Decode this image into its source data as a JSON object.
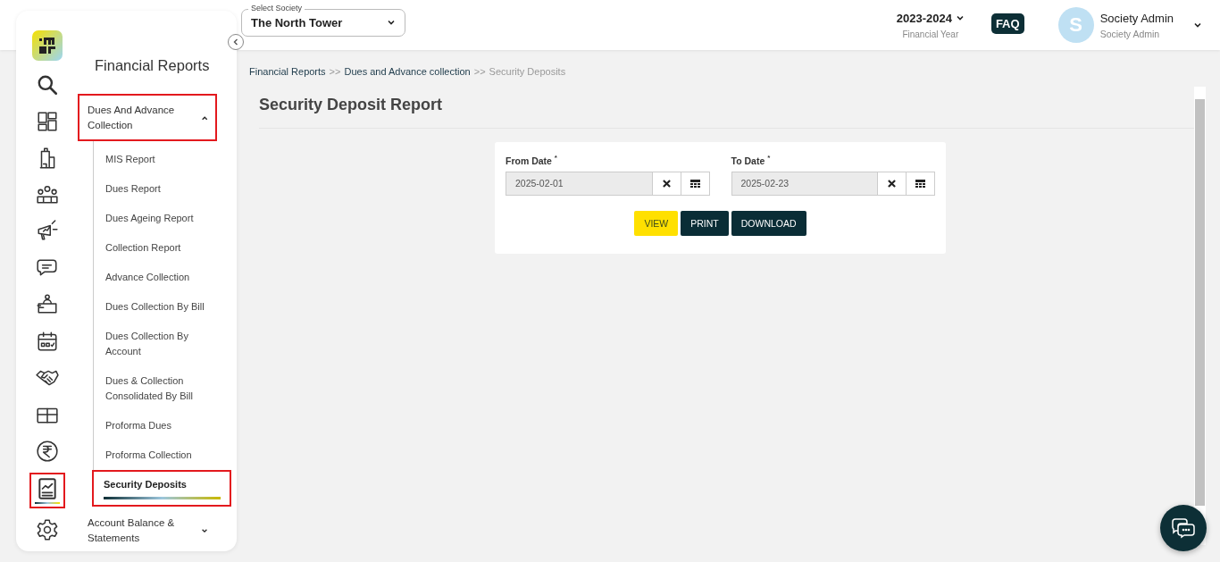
{
  "header": {
    "society_select": {
      "label": "Select Society",
      "value": "The North Tower"
    },
    "financial_year": {
      "value": "2023-2024",
      "label": "Financial Year"
    },
    "faq": "FAQ",
    "user": {
      "initial": "S",
      "name": "Society Admin",
      "role": "Society Admin"
    }
  },
  "rail": [
    {
      "kind": "logo",
      "selected": false,
      "highlighted": false
    },
    {
      "kind": "search",
      "selected": false,
      "highlighted": false
    },
    {
      "kind": "dashboard",
      "selected": false,
      "highlighted": false
    },
    {
      "kind": "building",
      "selected": false,
      "highlighted": false
    },
    {
      "kind": "people",
      "selected": false,
      "highlighted": false
    },
    {
      "kind": "megaphone",
      "selected": false,
      "highlighted": false
    },
    {
      "kind": "chat",
      "selected": false,
      "highlighted": false
    },
    {
      "kind": "desk",
      "selected": false,
      "highlighted": false
    },
    {
      "kind": "calendar",
      "selected": false,
      "highlighted": false
    },
    {
      "kind": "handshake",
      "selected": false,
      "highlighted": false
    },
    {
      "kind": "box",
      "selected": false,
      "highlighted": false
    },
    {
      "kind": "rupee",
      "selected": false,
      "highlighted": false
    },
    {
      "kind": "report",
      "selected": true,
      "highlighted": true
    },
    {
      "kind": "gear",
      "selected": false,
      "highlighted": false
    }
  ],
  "nav": {
    "title": "Financial Reports",
    "groups": [
      {
        "label": "Dues And Advance Collection",
        "expanded": true,
        "highlighted": true,
        "children": [
          {
            "label": "MIS Report",
            "selected": false,
            "highlighted": false
          },
          {
            "label": "Dues Report",
            "selected": false,
            "highlighted": false
          },
          {
            "label": "Dues Ageing Report",
            "selected": false,
            "highlighted": false
          },
          {
            "label": "Collection Report",
            "selected": false,
            "highlighted": false
          },
          {
            "label": "Advance Collection",
            "selected": false,
            "highlighted": false
          },
          {
            "label": "Dues Collection By Bill",
            "selected": false,
            "highlighted": false
          },
          {
            "label": "Dues Collection By Account",
            "selected": false,
            "highlighted": false
          },
          {
            "label": "Dues & Collection Consolidated By Bill",
            "selected": false,
            "highlighted": false
          },
          {
            "label": "Proforma Dues",
            "selected": false,
            "highlighted": false
          },
          {
            "label": "Proforma Collection",
            "selected": false,
            "highlighted": false
          },
          {
            "label": "Security Deposits",
            "selected": true,
            "highlighted": true
          }
        ]
      },
      {
        "label": "Account Balance & Statements",
        "expanded": false,
        "highlighted": false
      }
    ]
  },
  "breadcrumb": [
    {
      "label": "Financial Reports",
      "current": false
    },
    {
      "label": "Dues and Advance collection",
      "current": false
    },
    {
      "label": "Security Deposits",
      "current": true
    }
  ],
  "breadcrumb_separator": ">>",
  "page_title": "Security Deposit Report",
  "form": {
    "fields": [
      {
        "label": "From Date",
        "required_mark": "*",
        "value": "2025-02-01"
      },
      {
        "label": "To Date",
        "required_mark": "*",
        "value": "2025-02-23"
      }
    ],
    "buttons": [
      {
        "label": "VIEW",
        "kind": "primary"
      },
      {
        "label": "PRINT",
        "kind": "dark"
      },
      {
        "label": "DOWNLOAD",
        "kind": "dark"
      }
    ]
  }
}
